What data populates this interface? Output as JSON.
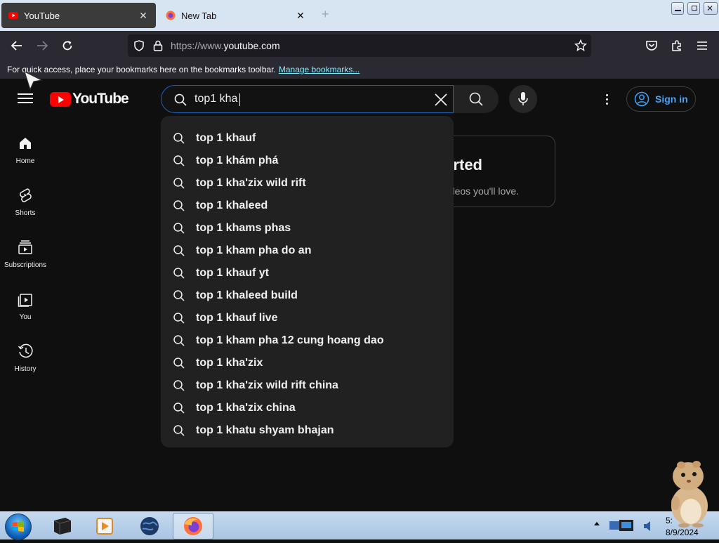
{
  "browser": {
    "tabs": [
      {
        "label": "YouTube",
        "active": true
      },
      {
        "label": "New Tab",
        "active": false
      }
    ],
    "tab_close_glyph": "✕",
    "new_tab_glyph": "+",
    "url": {
      "prefix": "https://www.",
      "domain": "youtube.com"
    },
    "bookmarks_bar": {
      "message": "For quick access, place your bookmarks here on the bookmarks toolbar.",
      "link": "Manage bookmarks..."
    }
  },
  "youtube": {
    "logo_text": "YouTube",
    "search": {
      "value": "top1 kha"
    },
    "signin_label": "Sign in",
    "sidebar": [
      {
        "label": "Home",
        "icon": "home-icon"
      },
      {
        "label": "Shorts",
        "icon": "shorts-icon"
      },
      {
        "label": "Subscriptions",
        "icon": "subscriptions-icon"
      },
      {
        "label": "You",
        "icon": "you-icon"
      },
      {
        "label": "History",
        "icon": "history-icon"
      }
    ],
    "card": {
      "title_fragment": "rted",
      "subtitle_fragment": "deos you'll love."
    },
    "suggestions": [
      "top 1 khauf",
      "top 1 khám phá",
      "top 1 kha'zix wild rift",
      "top 1 khaleed",
      "top 1 khams phas",
      "top 1 kham pha do an",
      "top 1 khauf yt",
      "top 1 khaleed build",
      "top 1 khauf live",
      "top 1 kham pha 12 cung hoang dao",
      "top 1 kha'zix",
      "top 1 kha'zix wild rift china",
      "top 1 kha'zix china",
      "top 1 khatu shyam bhajan"
    ]
  },
  "taskbar": {
    "clock_time": "5:",
    "clock_date": "8/9/2024"
  },
  "colors": {
    "accent_blue": "#3ea6ff",
    "yt_red": "#ff0000",
    "page_bg": "#0f0f0f",
    "dropdown_bg": "#212121"
  }
}
